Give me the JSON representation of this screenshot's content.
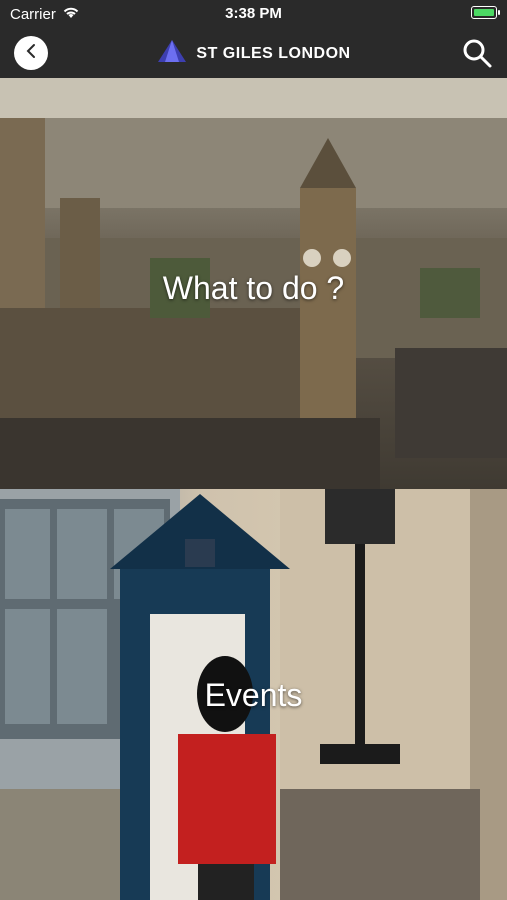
{
  "status": {
    "carrier": "Carrier",
    "time": "3:38 PM"
  },
  "nav": {
    "brand": "ST GILES LONDON"
  },
  "panels": [
    {
      "label": "What to do ?"
    },
    {
      "label": "Events"
    }
  ]
}
